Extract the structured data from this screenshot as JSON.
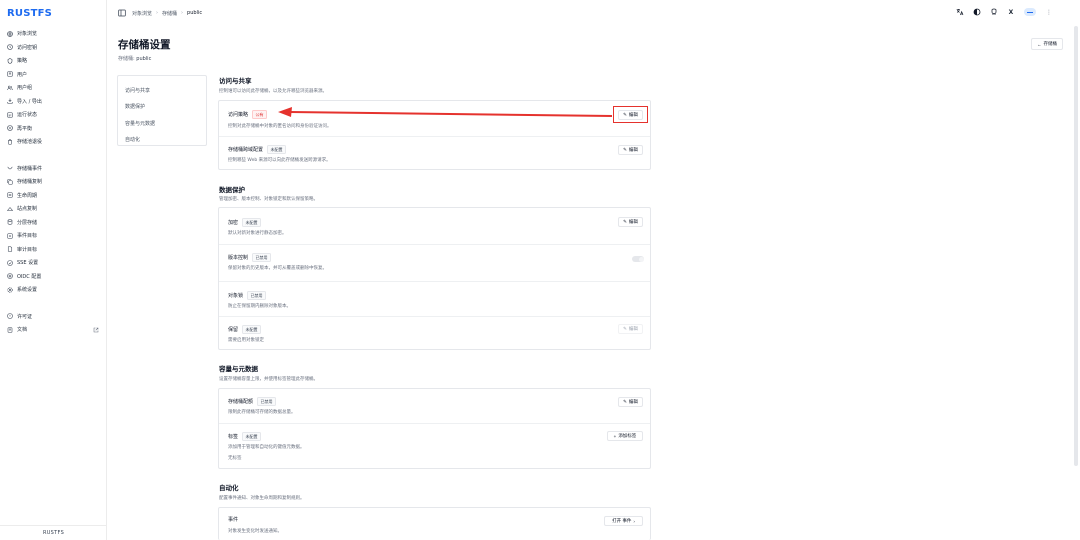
{
  "app": {
    "logo": "RUSTFS",
    "footer": "RUSTFS"
  },
  "sidebar": {
    "group1": [
      {
        "label": "对象浏览",
        "icon": "globe-icon"
      },
      {
        "label": "访问密钥",
        "icon": "key-icon"
      },
      {
        "label": "策略",
        "icon": "shield-icon"
      },
      {
        "label": "用户",
        "icon": "user-icon"
      },
      {
        "label": "用户组",
        "icon": "users-icon"
      },
      {
        "label": "导入 / 导出",
        "icon": "import-export-icon"
      },
      {
        "label": "运行状态",
        "icon": "status-icon"
      },
      {
        "label": "再平衡",
        "icon": "rebalance-icon"
      },
      {
        "label": "存储池退役",
        "icon": "decommission-icon"
      }
    ],
    "group2": [
      {
        "label": "存储桶事件",
        "icon": "event-icon"
      },
      {
        "label": "存储桶复制",
        "icon": "copy-icon"
      },
      {
        "label": "生命周期",
        "icon": "lifecycle-icon"
      },
      {
        "label": "站点复制",
        "icon": "site-replication-icon"
      },
      {
        "label": "分层存储",
        "icon": "tier-icon"
      },
      {
        "label": "事件目标",
        "icon": "target-icon"
      },
      {
        "label": "审计目标",
        "icon": "audit-icon"
      },
      {
        "label": "SSE 设置",
        "icon": "lock-icon"
      },
      {
        "label": "OIDC 配置",
        "icon": "oidc-icon"
      },
      {
        "label": "系统设置",
        "icon": "gear-icon"
      }
    ],
    "group3": [
      {
        "label": "许可证",
        "icon": "license-icon"
      },
      {
        "label": "文档",
        "icon": "book-icon"
      }
    ]
  },
  "topbar": {
    "breadcrumb": [
      "对象浏览",
      "存储桶",
      "public"
    ],
    "actions": [
      "translate-icon",
      "theme-icon",
      "github-icon",
      "x-icon"
    ],
    "x_label": "X",
    "more": "⋮"
  },
  "header": {
    "title": "存储桶设置",
    "subtitle_label": "存储桶:",
    "subtitle_value": "public",
    "back_label": "存储桶"
  },
  "section_nav": [
    "访问与共享",
    "数据保护",
    "容量与元数据",
    "自动化"
  ],
  "sections": {
    "access": {
      "title": "访问与共享",
      "desc": "控制谁可以访问此存储桶，以及允许哪些浏览器来源。",
      "rows": [
        {
          "title": "访问策略",
          "badge": "公有",
          "desc": "控制对此存储桶中对象的匿名访问和身份验证访问。",
          "action": "编辑"
        },
        {
          "title": "存储桶跨域配置",
          "badge": "未配置",
          "desc": "控制哪些 Web 来源可以向此存储桶发送跨源请求。",
          "action": "编辑"
        }
      ]
    },
    "protection": {
      "title": "数据保护",
      "desc": "管理加密、版本控制、对象锁定和默认保留策略。",
      "rows": [
        {
          "title": "加密",
          "badge": "未配置",
          "desc": "默认对新对象进行静态加密。",
          "action": "编辑"
        },
        {
          "title": "版本控制",
          "badge": "已禁用",
          "desc": "保留对象的历史版本，并可从覆盖或删除中恢复。"
        },
        {
          "title": "对象锁",
          "badge": "已禁用",
          "desc": "防止在保留期内删除对象版本。"
        },
        {
          "title": "保留",
          "badge": "未配置",
          "desc": "需要启用对象锁定",
          "action": "编辑"
        }
      ]
    },
    "capacity": {
      "title": "容量与元数据",
      "desc": "设置存储桶容量上限，并使用标签管理此存储桶。",
      "rows": [
        {
          "title": "存储桶配额",
          "badge": "已禁用",
          "desc": "限制此存储桶可存储的数据总量。",
          "action": "编辑"
        },
        {
          "title": "标签",
          "badge": "未配置",
          "desc": "添加用于管理和自动化的键值元数据。",
          "extra": "无标签",
          "action": "添加标签"
        }
      ]
    },
    "automation": {
      "title": "自动化",
      "desc": "配置事件通知、对象生命周期和复制规则。",
      "rows": [
        {
          "title": "事件",
          "desc": "对象发生变化时发送通知。",
          "action": "打开 事件"
        }
      ]
    }
  },
  "colors": {
    "brand": "#1e6bf0",
    "highlight": "#e5322d",
    "public_badge": "#dc2626"
  }
}
